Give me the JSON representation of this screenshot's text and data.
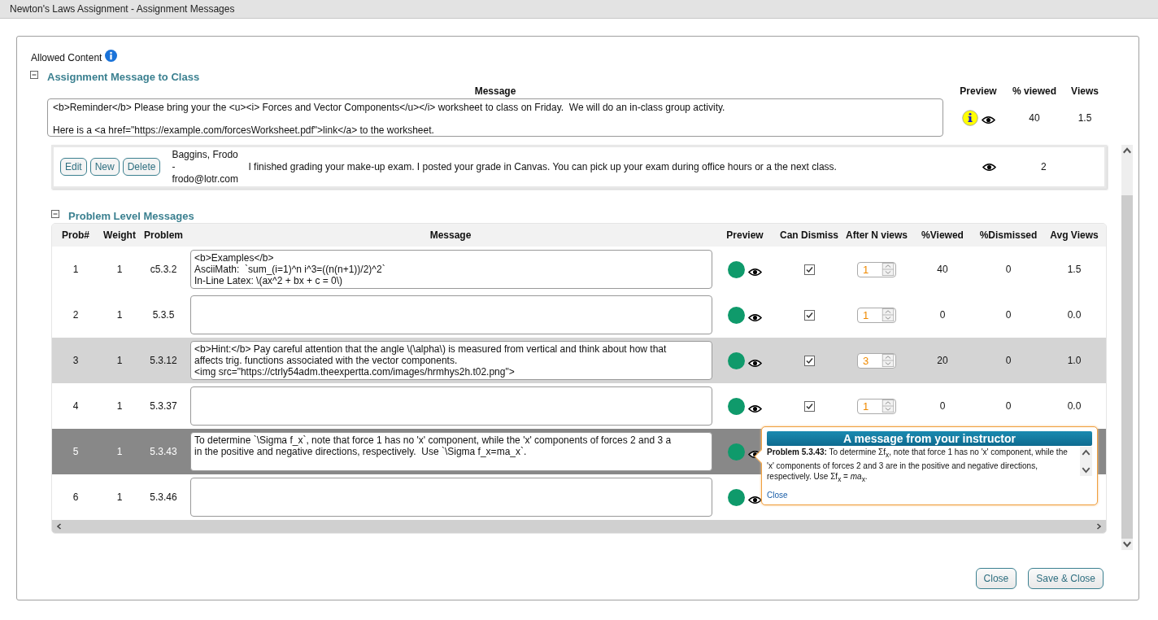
{
  "window": {
    "title": "Newton's Laws Assignment - Assignment Messages"
  },
  "allowed_content": {
    "label": "Allowed Content"
  },
  "class_message": {
    "title": "Assignment Message to Class",
    "expanded": true,
    "columns": [
      "Message",
      "Preview",
      "% viewed",
      "Views"
    ],
    "message": "<b>Reminder</b> Please bring your the <u><i> Forces and Vector Components</u></i> worksheet to class on Friday.  We will do an in-class group activity.\n\nHere is a <a href=\"https://example.com/forcesWorksheet.pdf\">link</a> to the worksheet.",
    "percent_viewed": "40",
    "views": "1.5"
  },
  "student_messages": [
    {
      "buttons": [
        "Edit",
        "New",
        "Delete"
      ],
      "author_lines": [
        "Baggins, Frodo",
        "-",
        "frodo@lotr.com"
      ],
      "message": "I finished grading your make-up exam. I posted your grade in Canvas. You can pick up your exam during office hours or a the next class.",
      "views": "2"
    }
  ],
  "problem_messages": {
    "title": "Problem Level Messages",
    "expanded": true,
    "columns": [
      "Prob#",
      "Weight",
      "Problem",
      "Message",
      "Preview",
      "Can Dismiss",
      "After N views",
      "%Viewed",
      "%Dismissed",
      "Avg Views"
    ],
    "rows": [
      {
        "num": "1",
        "weight": "1",
        "problem": "c5.3.2",
        "highlighted": false,
        "selected": false,
        "message": "<b>Examples</b>\nAsciiMath:  `sum_(i=1)^n i^3=((n(n+1))/2)^2`\nIn-Line Latex: \\(ax^2 + bx + c = 0\\)",
        "can_dismiss": true,
        "after_n": "1",
        "viewed": "40",
        "dismissed": "0",
        "avg_views": "1.5"
      },
      {
        "num": "2",
        "weight": "1",
        "problem": "5.3.5",
        "highlighted": false,
        "selected": false,
        "can_dismiss": true,
        "after_n": "1",
        "viewed": "0",
        "dismissed": "0",
        "avg_views": "0.0"
      },
      {
        "num": "3",
        "weight": "1",
        "problem": "5.3.12",
        "highlighted": true,
        "selected": false,
        "message": "<b>Hint:</b> Pay careful attention that the angle \\(\\alpha\\) is measured from vertical and think about how that\naffects trig. functions associated with the vector components.\n<img src=\"https://ctrly54adm.theexpertta.com/images/hrmhys2h.t02.png\">",
        "can_dismiss": true,
        "after_n": "3",
        "viewed": "20",
        "dismissed": "0",
        "avg_views": "1.0"
      },
      {
        "num": "4",
        "weight": "1",
        "problem": "5.3.37",
        "highlighted": false,
        "selected": false,
        "can_dismiss": true,
        "after_n": "1",
        "viewed": "0",
        "dismissed": "0",
        "avg_views": "0.0"
      },
      {
        "num": "5",
        "weight": "1",
        "problem": "5.3.43",
        "highlighted": false,
        "selected": true,
        "message": "To determine `\\Sigma f_x`, note that force 1 has no 'x' component, while the 'x' components of forces 2 and 3 a\nin the positive and negative directions, respectively.  Use `\\Sigma f_x=ma_x`."
      },
      {
        "num": "6",
        "weight": "1",
        "problem": "5.3.46",
        "highlighted": false,
        "selected": false
      }
    ]
  },
  "popup": {
    "title": "A message from your instructor",
    "text": "**Problem 5.3.43:** To determine Σf$_{x}$, note that force 1 has no 'x' component, while the 'x' components of forces 2 and 3 are in the positive and negative directions, respectively. Use Σf$_{x}$ = *ma*$_{x}$.",
    "close": "Close"
  },
  "buttons": [
    "Close",
    "Save & Close"
  ]
}
